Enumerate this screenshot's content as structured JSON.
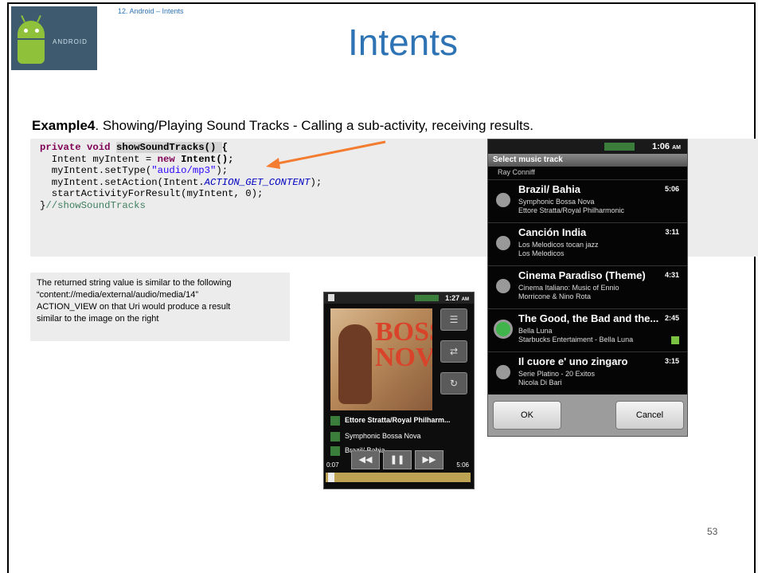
{
  "slide": {
    "breadcrumb": "12. Android – Intents",
    "title": "Intents",
    "heading_label": "Example4",
    "heading_text": ".  Showing/Playing Sound Tracks - Calling a sub-activity, receiving results.",
    "logo_text": "ANDROID",
    "page_number": "53"
  },
  "code": {
    "l1_kw": "private void ",
    "l1_name": "showSoundTracks() ",
    "l1_brace": "{",
    "l2_a": "  Intent myIntent = ",
    "l2_kw": "new ",
    "l2_b": "Intent();",
    "l3_a": "  myIntent.setType(",
    "l3_str": "\"audio/mp3\"",
    "l3_b": ");",
    "l4_a": "  myIntent.setAction(Intent.",
    "l4_const": "ACTION_GET_CONTENT",
    "l4_b": ");",
    "l5": "  startActivityForResult(myIntent, 0);",
    "l6_brace": "}",
    "l6_comment": "//showSoundTracks"
  },
  "note": {
    "line1": "The returned string value is similar to the following",
    "line2": "“content://media/external/audio/media/14”",
    "line3": "ACTION_VIEW on that Uri would produce a result",
    "line4": "similar to the image on the right"
  },
  "player": {
    "status_time": "1:27",
    "status_ampm": "AM",
    "album_text": "BOSSA NOVA",
    "artist": "Ettore Stratta/Royal Philharm...",
    "album": "Symphonic Bossa Nova",
    "track": "Brazil/ Bahia",
    "elapsed": "0:07",
    "duration": "5:06",
    "progress": 0.02,
    "btn_list": "☰",
    "btn_shuffle": "⇄",
    "btn_repeat": "↻",
    "btn_prev": "◀◀",
    "btn_pause": "❚❚",
    "btn_next": "▶▶"
  },
  "chooser": {
    "status_time": "1:06",
    "status_ampm": "AM",
    "header": "Select music track",
    "top_partial": "Ray Conniff",
    "rows": [
      {
        "title": "Brazil/ Bahia",
        "duration": "5:06",
        "sub1": "Symphonic Bossa Nova",
        "sub2": "Ettore Stratta/Royal Philharmonic",
        "selected": false
      },
      {
        "title": "Canción India",
        "duration": "3:11",
        "sub1": "Los Melodicos tocan jazz",
        "sub2": "Los Melodicos",
        "selected": false
      },
      {
        "title": "Cinema Paradiso (Theme)",
        "duration": "4:31",
        "sub1": "Cinema Italiano: Music of Ennio",
        "sub2": "Morricone & Nino Rota",
        "selected": false
      },
      {
        "title": "The Good, the Bad and the...",
        "duration": "2:45",
        "sub1": "Bella Luna",
        "sub2": "Starbucks Entertaiment - Bella Luna",
        "selected": true
      },
      {
        "title": "Il cuore e' uno zingaro",
        "duration": "3:15",
        "sub1": "Serie Platino - 20 Exitos",
        "sub2": "Nicola Di Bari",
        "selected": false
      }
    ],
    "ok_label": "OK",
    "cancel_label": "Cancel"
  }
}
